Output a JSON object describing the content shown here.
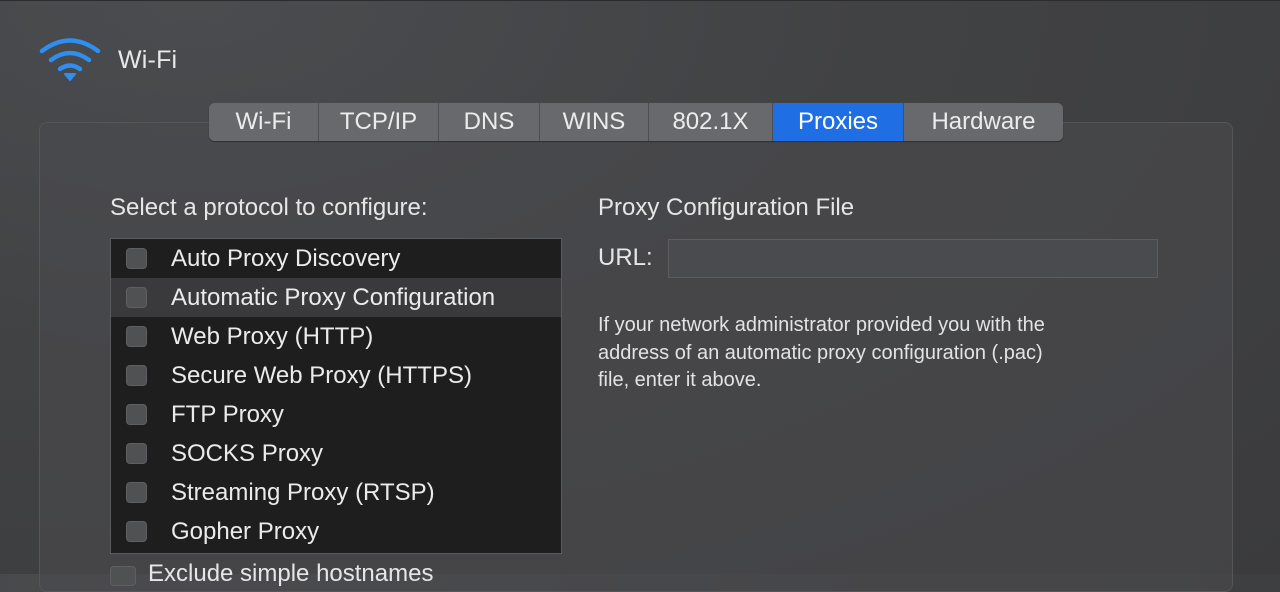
{
  "header": {
    "icon": "wifi-icon",
    "title": "Wi-Fi",
    "icon_color": "#2f8ff0"
  },
  "tabs": [
    {
      "label": "Wi-Fi",
      "selected": false
    },
    {
      "label": "TCP/IP",
      "selected": false
    },
    {
      "label": "DNS",
      "selected": false
    },
    {
      "label": "WINS",
      "selected": false
    },
    {
      "label": "802.1X",
      "selected": false
    },
    {
      "label": "Proxies",
      "selected": true
    },
    {
      "label": "Hardware",
      "selected": false
    }
  ],
  "accent_color": "#1f6ee3",
  "protocols": {
    "heading": "Select a protocol to configure:",
    "items": [
      {
        "label": "Auto Proxy Discovery",
        "checked": false,
        "highlighted": false
      },
      {
        "label": "Automatic Proxy Configuration",
        "checked": false,
        "highlighted": true
      },
      {
        "label": "Web Proxy (HTTP)",
        "checked": false,
        "highlighted": false
      },
      {
        "label": "Secure Web Proxy (HTTPS)",
        "checked": false,
        "highlighted": false
      },
      {
        "label": "FTP Proxy",
        "checked": false,
        "highlighted": false
      },
      {
        "label": "SOCKS Proxy",
        "checked": false,
        "highlighted": false
      },
      {
        "label": "Streaming Proxy (RTSP)",
        "checked": false,
        "highlighted": false
      },
      {
        "label": "Gopher Proxy",
        "checked": false,
        "highlighted": false
      }
    ]
  },
  "bottom_option": {
    "label": "Exclude simple hostnames",
    "checked": false
  },
  "config": {
    "title": "Proxy Configuration File",
    "url_label": "URL:",
    "url_value": "",
    "help_lines": [
      "If your network administrator provided you with the",
      "address of an automatic proxy configuration (.pac)",
      "file, enter it above."
    ]
  }
}
